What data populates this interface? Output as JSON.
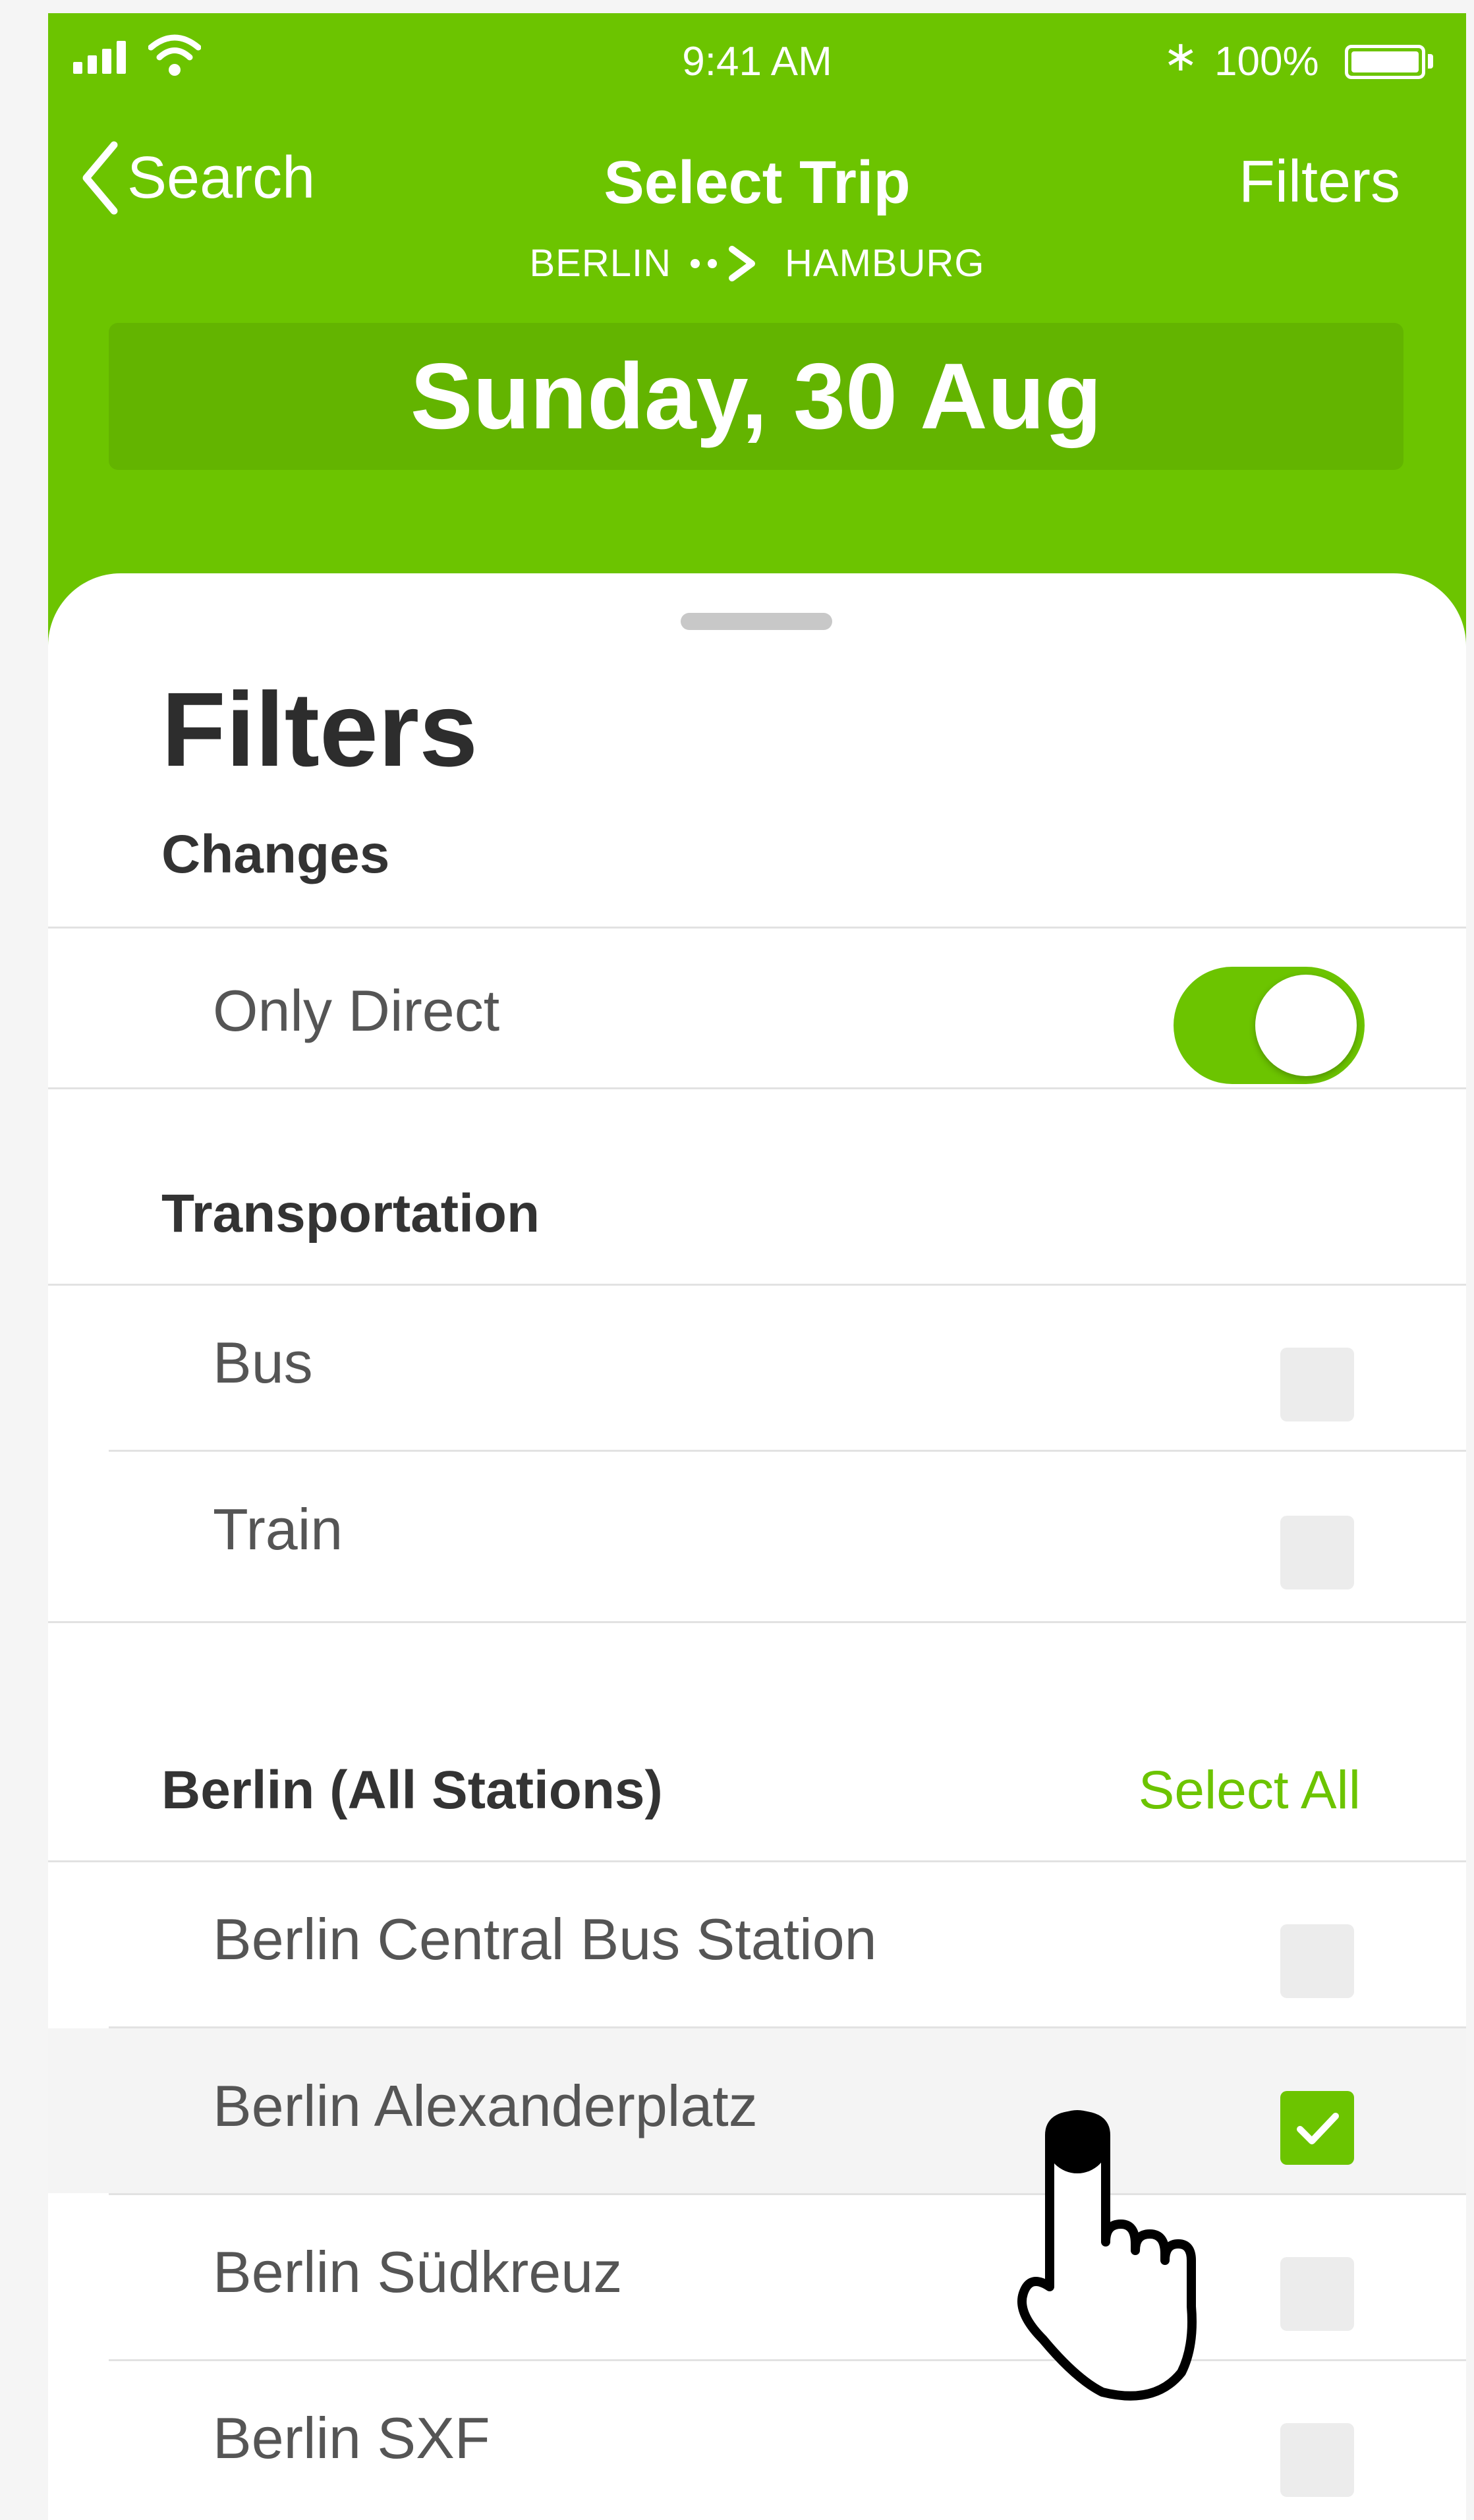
{
  "status_bar": {
    "time": "9:41 AM",
    "battery_percent": "100%",
    "battery_level": 1.0,
    "icons": [
      "signal-bars-icon",
      "wifi-icon",
      "bluetooth-icon",
      "battery-icon"
    ]
  },
  "nav": {
    "back_label": "Search",
    "title": "Select Trip",
    "origin": "BERLIN",
    "destination": "HAMBURG",
    "filters_label": "Filters",
    "date": "Sunday, 30 Aug"
  },
  "sheet": {
    "title": "Filters",
    "changes": {
      "header": "Changes",
      "only_direct": {
        "label": "Only Direct",
        "on": true
      }
    },
    "transportation": {
      "header": "Transportation",
      "items": [
        {
          "label": "Bus",
          "checked": false
        },
        {
          "label": "Train",
          "checked": false
        }
      ]
    },
    "berlin": {
      "header": "Berlin (All Stations)",
      "select_all_label": "Select All",
      "items": [
        {
          "label": "Berlin Central Bus Station",
          "checked": false
        },
        {
          "label": "Berlin Alexanderplatz",
          "checked": true
        },
        {
          "label": "Berlin Südkreuz",
          "checked": false
        },
        {
          "label": "Berlin SXF",
          "checked": false
        }
      ]
    }
  },
  "colors": {
    "brand_green": "#6cc400",
    "date_bar_green": "#63b400",
    "checkbox_off": "#ececec"
  }
}
